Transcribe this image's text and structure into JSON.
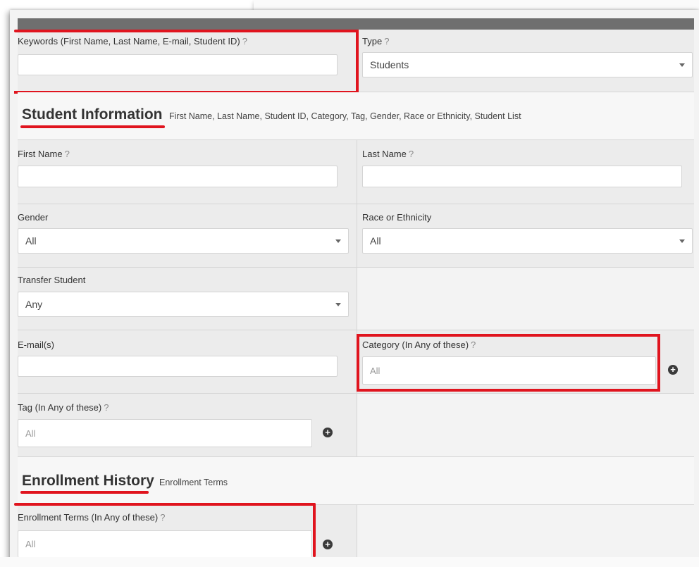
{
  "keywords": {
    "label": "Keywords (First Name, Last Name, E-mail, Student ID)",
    "help": "?",
    "value": ""
  },
  "type": {
    "label": "Type",
    "help": "?",
    "selected": "Students"
  },
  "student_info": {
    "title": "Student Information",
    "subtitle": "First Name, Last Name, Student ID, Category, Tag, Gender, Race or Ethnicity, Student List"
  },
  "first_name": {
    "label": "First Name",
    "help": "?",
    "value": ""
  },
  "last_name": {
    "label": "Last Name",
    "help": "?",
    "value": ""
  },
  "gender": {
    "label": "Gender",
    "selected": "All"
  },
  "race": {
    "label": "Race or Ethnicity",
    "selected": "All"
  },
  "transfer": {
    "label": "Transfer Student",
    "selected": "Any"
  },
  "emails": {
    "label": "E-mail(s)",
    "value": ""
  },
  "category": {
    "label": "Category (In Any of these)",
    "help": "?",
    "placeholder": "All"
  },
  "tag": {
    "label": "Tag (In Any of these)",
    "help": "?",
    "placeholder": "All"
  },
  "enrollment_history": {
    "title": "Enrollment History",
    "subtitle": "Enrollment Terms"
  },
  "enrollment_terms": {
    "label": "Enrollment Terms (In Any of these)",
    "help": "?",
    "placeholder": "All"
  },
  "icons": {
    "add": "plus-circle-icon",
    "dropdown": "caret-down-icon"
  },
  "colors": {
    "highlight": "#e0141e",
    "header_bar": "#6f6f6f",
    "panel": "#ececec"
  }
}
